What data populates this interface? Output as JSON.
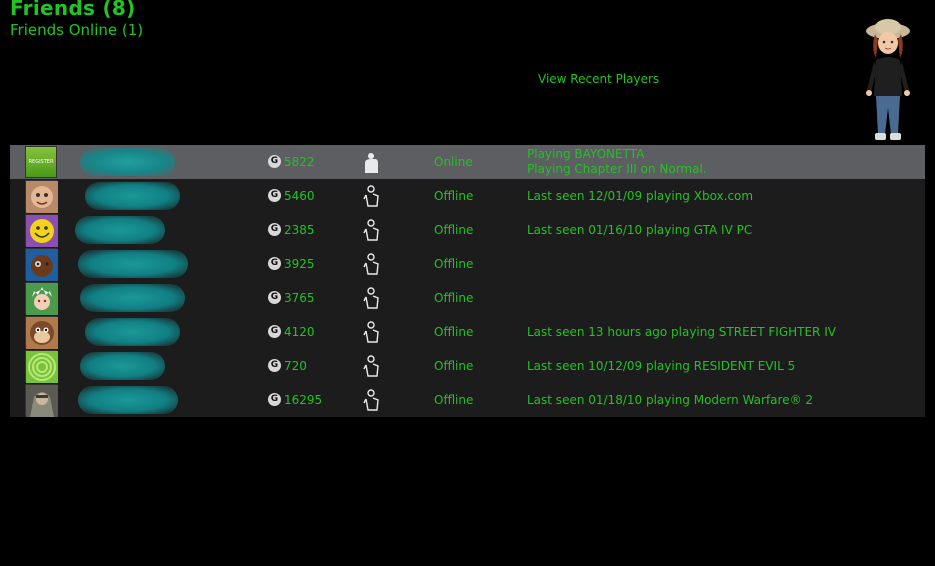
{
  "header": {
    "title": "Friends (8)",
    "subtitle": "Friends Online (1)",
    "recent_players_link": "View Recent Players"
  },
  "colors": {
    "accent_green": "#22c322",
    "row_background": "#1c1c1c",
    "selected_row": "#5c5e61",
    "redaction_teal": "#1ca6a6"
  },
  "friends": [
    {
      "gamerscore": "5822",
      "status": "Online",
      "activity": [
        "Playing BAYONETTA",
        "Playing Chapter III on Normal."
      ],
      "gamerpic": "register-tile",
      "presence_icon": "online-person-icon"
    },
    {
      "gamerscore": "5460",
      "status": "Offline",
      "activity": [
        "Last seen 12/01/09 playing Xbox.com"
      ],
      "gamerpic": "avatar-face",
      "presence_icon": "offline-person-icon"
    },
    {
      "gamerscore": "2385",
      "status": "Offline",
      "activity": [
        "Last seen 01/16/10 playing GTA IV PC"
      ],
      "gamerpic": "smiley",
      "presence_icon": "offline-person-icon"
    },
    {
      "gamerscore": "3925",
      "status": "Offline",
      "activity": [],
      "gamerpic": "dark-face",
      "presence_icon": "offline-person-icon"
    },
    {
      "gamerscore": "3765",
      "status": "Offline",
      "activity": [],
      "gamerpic": "white-hair-face",
      "presence_icon": "offline-person-icon"
    },
    {
      "gamerscore": "4120",
      "status": "Offline",
      "activity": [
        "Last seen 13 hours ago playing STREET FIGHTER IV"
      ],
      "gamerpic": "monkey",
      "presence_icon": "offline-person-icon"
    },
    {
      "gamerscore": "720",
      "status": "Offline",
      "activity": [
        "Last seen 10/12/09 playing RESIDENT EVIL 5"
      ],
      "gamerpic": "green-rings",
      "presence_icon": "offline-person-icon"
    },
    {
      "gamerscore": "16295",
      "status": "Offline",
      "activity": [
        "Last seen 01/18/10 playing Modern Warfare® 2"
      ],
      "gamerpic": "soldier",
      "presence_icon": "offline-person-icon"
    }
  ]
}
